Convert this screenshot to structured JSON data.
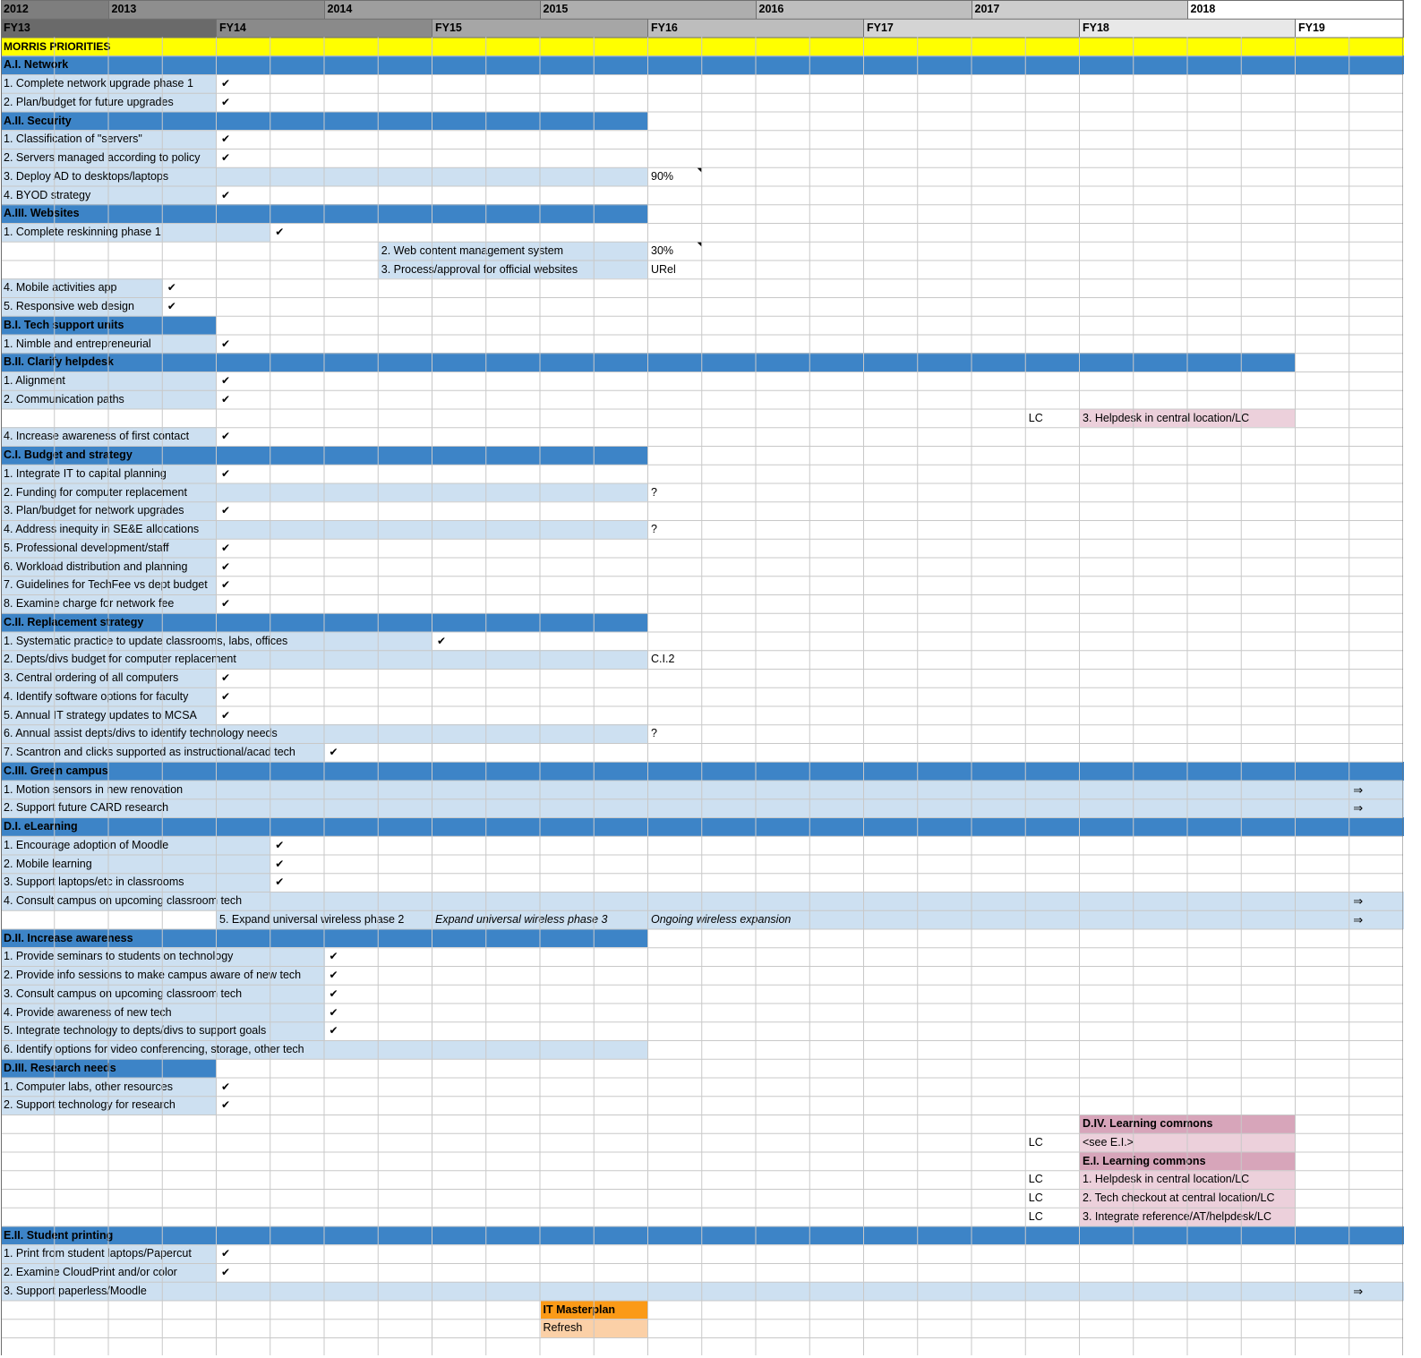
{
  "years": [
    "2012",
    "2013",
    "2014",
    "2015",
    "2016",
    "2017",
    "2018"
  ],
  "fiscal_years": [
    "FY13",
    "FY14",
    "FY15",
    "FY16",
    "FY17",
    "FY18",
    "FY19"
  ],
  "colors": {
    "section_blue": "#3d84c7",
    "bar_light_blue": "#cde0f1",
    "priorities_yellow": "#ffff00",
    "lc_pink": "#ecd0db",
    "lc_pink_header": "#d7a5ba",
    "masterplan_orange": "#fb9a17",
    "refresh_peach": "#fbd0a7"
  },
  "symbols": {
    "check": "✔",
    "arrow": "⇒"
  },
  "rows": [
    {
      "row": 2,
      "label": "MORRIS PRIORITIES",
      "kind": "priorities"
    },
    {
      "row": 3,
      "label": "A.I. Network",
      "kind": "section",
      "span_end": 26
    },
    {
      "row": 4,
      "label": "1. Complete network upgrade phase 1",
      "bar_end": 4,
      "mark": "✔",
      "mark_col": 4
    },
    {
      "row": 5,
      "label": "2. Plan/budget for future upgrades",
      "bar_end": 4,
      "mark": "✔",
      "mark_col": 4
    },
    {
      "row": 6,
      "label": "A.II. Security",
      "kind": "section",
      "span_end": 12
    },
    {
      "row": 7,
      "label": "1. Classification of \"servers\"",
      "bar_end": 4,
      "mark": "✔",
      "mark_col": 4
    },
    {
      "row": 8,
      "label": "2. Servers managed according to policy",
      "bar_end": 4,
      "mark": "✔",
      "mark_col": 4
    },
    {
      "row": 9,
      "label": "3. Deploy AD to desktops/laptops",
      "bar_end": 12,
      "mark": "90%",
      "mark_col": 12,
      "note": true
    },
    {
      "row": 10,
      "label": "4. BYOD strategy",
      "bar_end": 4,
      "mark": "✔",
      "mark_col": 4
    },
    {
      "row": 11,
      "label": "A.III. Websites",
      "kind": "section",
      "span_end": 12
    },
    {
      "row": 12,
      "label": "1. Complete reskinning phase 1",
      "bar_end": 5,
      "mark": "✔",
      "mark_col": 5
    },
    {
      "row": 13,
      "label": "2. Web content management system",
      "bar_start": 7,
      "bar_end": 12,
      "mark": "30%",
      "mark_col": 12,
      "note": true
    },
    {
      "row": 14,
      "label": "3. Process/approval for official websites",
      "bar_start": 7,
      "bar_end": 12,
      "mark": "URel",
      "mark_col": 12
    },
    {
      "row": 15,
      "label": "4. Mobile activities app",
      "bar_end": 3,
      "mark": "✔",
      "mark_col": 3
    },
    {
      "row": 16,
      "label": "5. Responsive web design",
      "bar_end": 3,
      "mark": "✔",
      "mark_col": 3
    },
    {
      "row": 17,
      "label": "B.I. Tech support units",
      "kind": "section",
      "span_end": 4
    },
    {
      "row": 18,
      "label": "1. Nimble and entrepreneurial",
      "bar_end": 4,
      "mark": "✔",
      "mark_col": 4
    },
    {
      "row": 19,
      "label": "B.II. Clarify helpdesk",
      "kind": "section",
      "span_end": 24
    },
    {
      "row": 20,
      "label": "1. Alignment",
      "bar_end": 4,
      "mark": "✔",
      "mark_col": 4
    },
    {
      "row": 21,
      "label": "2. Communication paths",
      "bar_end": 4,
      "mark": "✔",
      "mark_col": 4
    },
    {
      "row": 22,
      "label": "3. Helpdesk in central location/LC",
      "kind": "lc",
      "bar_start": 20,
      "bar_end": 24,
      "lc": "LC"
    },
    {
      "row": 23,
      "label": "4. Increase awareness of first contact",
      "bar_end": 4,
      "mark": "✔",
      "mark_col": 4
    },
    {
      "row": 24,
      "label": "C.I. Budget and strategy",
      "kind": "section",
      "span_end": 12
    },
    {
      "row": 25,
      "label": "1. Integrate IT to capital planning",
      "bar_end": 4,
      "mark": "✔",
      "mark_col": 4
    },
    {
      "row": 26,
      "label": "2. Funding for computer replacement",
      "bar_end": 12,
      "mark": "?",
      "mark_col": 12
    },
    {
      "row": 27,
      "label": "3. Plan/budget for network upgrades",
      "bar_end": 4,
      "mark": "✔",
      "mark_col": 4
    },
    {
      "row": 28,
      "label": "4. Address inequity in SE&E allocations",
      "bar_end": 12,
      "mark": "?",
      "mark_col": 12
    },
    {
      "row": 29,
      "label": "5. Professional development/staff",
      "bar_end": 4,
      "mark": "✔",
      "mark_col": 4
    },
    {
      "row": 30,
      "label": "6. Workload distribution and planning",
      "bar_end": 4,
      "mark": "✔",
      "mark_col": 4
    },
    {
      "row": 31,
      "label": "7. Guidelines for TechFee vs dept budget",
      "bar_end": 4,
      "mark": "✔",
      "mark_col": 4
    },
    {
      "row": 32,
      "label": "8. Examine charge for network fee",
      "bar_end": 4,
      "mark": "✔",
      "mark_col": 4
    },
    {
      "row": 33,
      "label": "C.II. Replacement strategy",
      "kind": "section",
      "span_end": 12
    },
    {
      "row": 34,
      "label": "1. Systematic practice to update classrooms, labs, offices",
      "bar_end": 8,
      "mark": "✔",
      "mark_col": 8
    },
    {
      "row": 35,
      "label": "2. Depts/divs budget for computer replacement",
      "bar_end": 12,
      "mark": "C.I.2",
      "mark_col": 12
    },
    {
      "row": 36,
      "label": "3. Central ordering of all computers",
      "bar_end": 4,
      "mark": "✔",
      "mark_col": 4
    },
    {
      "row": 37,
      "label": "4. Identify software options for faculty",
      "bar_end": 4,
      "mark": "✔",
      "mark_col": 4
    },
    {
      "row": 38,
      "label": "5. Annual IT strategy updates to MCSA",
      "bar_end": 4,
      "mark": "✔",
      "mark_col": 4
    },
    {
      "row": 39,
      "label": "6. Annual assist depts/divs to identify technology needs",
      "bar_end": 12,
      "mark": "?",
      "mark_col": 12
    },
    {
      "row": 40,
      "label": "7. Scantron and clicks supported as instructional/acad tech",
      "bar_end": 6,
      "mark": "✔",
      "mark_col": 6
    },
    {
      "row": 41,
      "label": "C.III. Green campus",
      "kind": "section",
      "span_end": 26
    },
    {
      "row": 42,
      "label": "1. Motion sensors in new renovation",
      "bar_end": 26,
      "mark": "⇒",
      "mark_col": 25
    },
    {
      "row": 43,
      "label": "2. Support future CARD research",
      "bar_end": 26,
      "mark": "⇒",
      "mark_col": 25
    },
    {
      "row": 44,
      "label": "D.I. eLearning",
      "kind": "section",
      "span_end": 26
    },
    {
      "row": 45,
      "label": "1. Encourage adoption of Moodle",
      "bar_end": 5,
      "mark": "✔",
      "mark_col": 5
    },
    {
      "row": 46,
      "label": "2. Mobile learning",
      "bar_end": 5,
      "mark": "✔",
      "mark_col": 5
    },
    {
      "row": 47,
      "label": "3. Support laptops/etc in classrooms",
      "bar_end": 5,
      "mark": "✔",
      "mark_col": 5
    },
    {
      "row": 48,
      "label": "4. Consult campus on upcoming classroom tech",
      "bar_end": 26,
      "mark": "⇒",
      "mark_col": 25
    },
    {
      "row": 49,
      "label": "5. Expand universal wireless phase 2",
      "kind": "wireless",
      "bar_start": 4,
      "bar_end": 26,
      "phase3": "Expand universal wireless phase 3",
      "ongoing": "Ongoing wireless expansion",
      "mark": "⇒",
      "mark_col": 25
    },
    {
      "row": 50,
      "label": "D.II. Increase awareness",
      "kind": "section",
      "span_end": 12
    },
    {
      "row": 51,
      "label": "1. Provide seminars to students on technology",
      "bar_end": 6,
      "mark": "✔",
      "mark_col": 6
    },
    {
      "row": 52,
      "label": "2. Provide info sessions to make campus aware of new tech",
      "bar_end": 6,
      "mark": "✔",
      "mark_col": 6
    },
    {
      "row": 53,
      "label": "3. Consult campus on upcoming classroom tech",
      "bar_end": 6,
      "mark": "✔",
      "mark_col": 6
    },
    {
      "row": 54,
      "label": "4. Provide awareness of new tech",
      "bar_end": 6,
      "mark": "✔",
      "mark_col": 6
    },
    {
      "row": 55,
      "label": "5. Integrate technology to depts/divs to support goals",
      "bar_end": 6,
      "mark": "✔",
      "mark_col": 6
    },
    {
      "row": 56,
      "label": "6. Identify options for video conferencing, storage, other tech",
      "bar_end": 12
    },
    {
      "row": 57,
      "label": "D.III. Research needs",
      "kind": "section",
      "span_end": 4
    },
    {
      "row": 58,
      "label": "1. Computer labs, other resources",
      "bar_end": 4,
      "mark": "✔",
      "mark_col": 4
    },
    {
      "row": 59,
      "label": "2. Support technology for research",
      "bar_end": 4,
      "mark": "✔",
      "mark_col": 4
    },
    {
      "row": 60,
      "label": "D.IV. Learning commons",
      "kind": "lc_header",
      "bar_start": 20,
      "bar_end": 24
    },
    {
      "row": 61,
      "label": "<see E.I.>",
      "kind": "lc",
      "bar_start": 20,
      "bar_end": 24,
      "lc": "LC"
    },
    {
      "row": 62,
      "label": "E.I. Learning commons",
      "kind": "lc_header",
      "bar_start": 20,
      "bar_end": 24
    },
    {
      "row": 63,
      "label": "1. Helpdesk in central location/LC",
      "kind": "lc",
      "bar_start": 20,
      "bar_end": 24,
      "lc": "LC"
    },
    {
      "row": 64,
      "label": "2. Tech checkout at central location/LC",
      "kind": "lc",
      "bar_start": 20,
      "bar_end": 24,
      "lc": "LC"
    },
    {
      "row": 65,
      "label": "3. Integrate reference/AT/helpdesk/LC",
      "kind": "lc",
      "bar_start": 20,
      "bar_end": 24,
      "lc": "LC"
    },
    {
      "row": 66,
      "label": "E.II. Student printing",
      "kind": "section",
      "span_end": 26
    },
    {
      "row": 67,
      "label": "1. Print from student laptops/Papercut",
      "bar_end": 4,
      "mark": "✔",
      "mark_col": 4
    },
    {
      "row": 68,
      "label": "2. Examine CloudPrint and/or color",
      "bar_end": 4,
      "mark": "✔",
      "mark_col": 4
    },
    {
      "row": 69,
      "label": "3. Support paperless/Moodle",
      "bar_end": 26,
      "mark": "⇒",
      "mark_col": 25
    },
    {
      "row": 70,
      "label": "IT Masterplan",
      "kind": "masterplan",
      "bar_start": 10,
      "bar_end": 12
    },
    {
      "row": 71,
      "label": "Refresh",
      "kind": "refresh",
      "bar_start": 10,
      "bar_end": 12
    }
  ]
}
